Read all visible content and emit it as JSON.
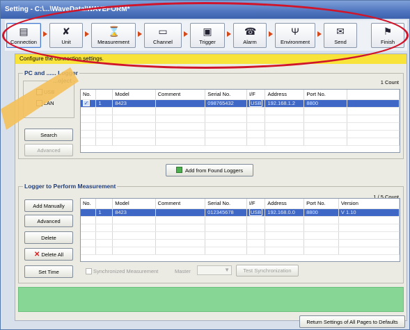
{
  "window": {
    "title": "Setting - C:\\...\\WaveData\\WAVEFORM*"
  },
  "toolbar": {
    "buttons": [
      {
        "label": "Connection",
        "icon": "network-icon"
      },
      {
        "label": "Unit",
        "icon": "tools-icon"
      },
      {
        "label": "Measurement",
        "icon": "hourglass-icon"
      },
      {
        "label": "Channel",
        "icon": "waveform-icon"
      },
      {
        "label": "Trigger",
        "icon": "trigger-icon"
      },
      {
        "label": "Alarm",
        "icon": "alarm-icon"
      },
      {
        "label": "Environment",
        "icon": "antenna-icon"
      },
      {
        "label": "Send",
        "icon": "send-icon"
      },
      {
        "label": "Finish",
        "icon": "flag-icon"
      }
    ]
  },
  "banner": {
    "text": "Configure the connection settings."
  },
  "found": {
    "title": "PC and ...... Logger",
    "subgroup_title": "...oject",
    "usb_label": "USB",
    "lan_label": "LAN",
    "count": "1 Count",
    "search_label": "Search",
    "advanced_label": "Advanced",
    "columns": [
      "No.",
      "Model",
      "Comment",
      "Serial No.",
      "I/F",
      "Address",
      "Port No."
    ],
    "rows": [
      {
        "no": "1",
        "model": "8423",
        "comment": "",
        "serial": "098765432",
        "iface": "USB",
        "address": "192.168.1.2",
        "port": "8800"
      }
    ]
  },
  "add_found_label": "Add from Found Loggers",
  "measure": {
    "title": "Logger to Perform Measurement",
    "count": "1 / 5 Count",
    "add_manually_label": "Add Manually",
    "advanced_label": "Advanced",
    "delete_label": "Delete",
    "delete_all_label": "Delete All",
    "set_time_label": "Set Time",
    "sync_label": "Synchronized Measurement",
    "master_label": "Master",
    "test_sync_label": "Test Synchronization",
    "columns": [
      "No.",
      "Model",
      "Comment",
      "Serial No.",
      "I/F",
      "Address",
      "Port No.",
      "Version"
    ],
    "rows": [
      {
        "no": "1",
        "model": "8423",
        "comment": "",
        "serial": "012345678",
        "iface": "USB",
        "address": "192.168.0.0",
        "port": "8800",
        "version": "V 1.10"
      }
    ]
  },
  "return_defaults_label": "Return Settings of All Pages to Defaults",
  "colors": {
    "highlight_oval": "#d0152a",
    "banner": "#f8e33a",
    "selection": "#3f68c6",
    "status_bar": "#87d696",
    "pointer": "#f5c15a"
  }
}
